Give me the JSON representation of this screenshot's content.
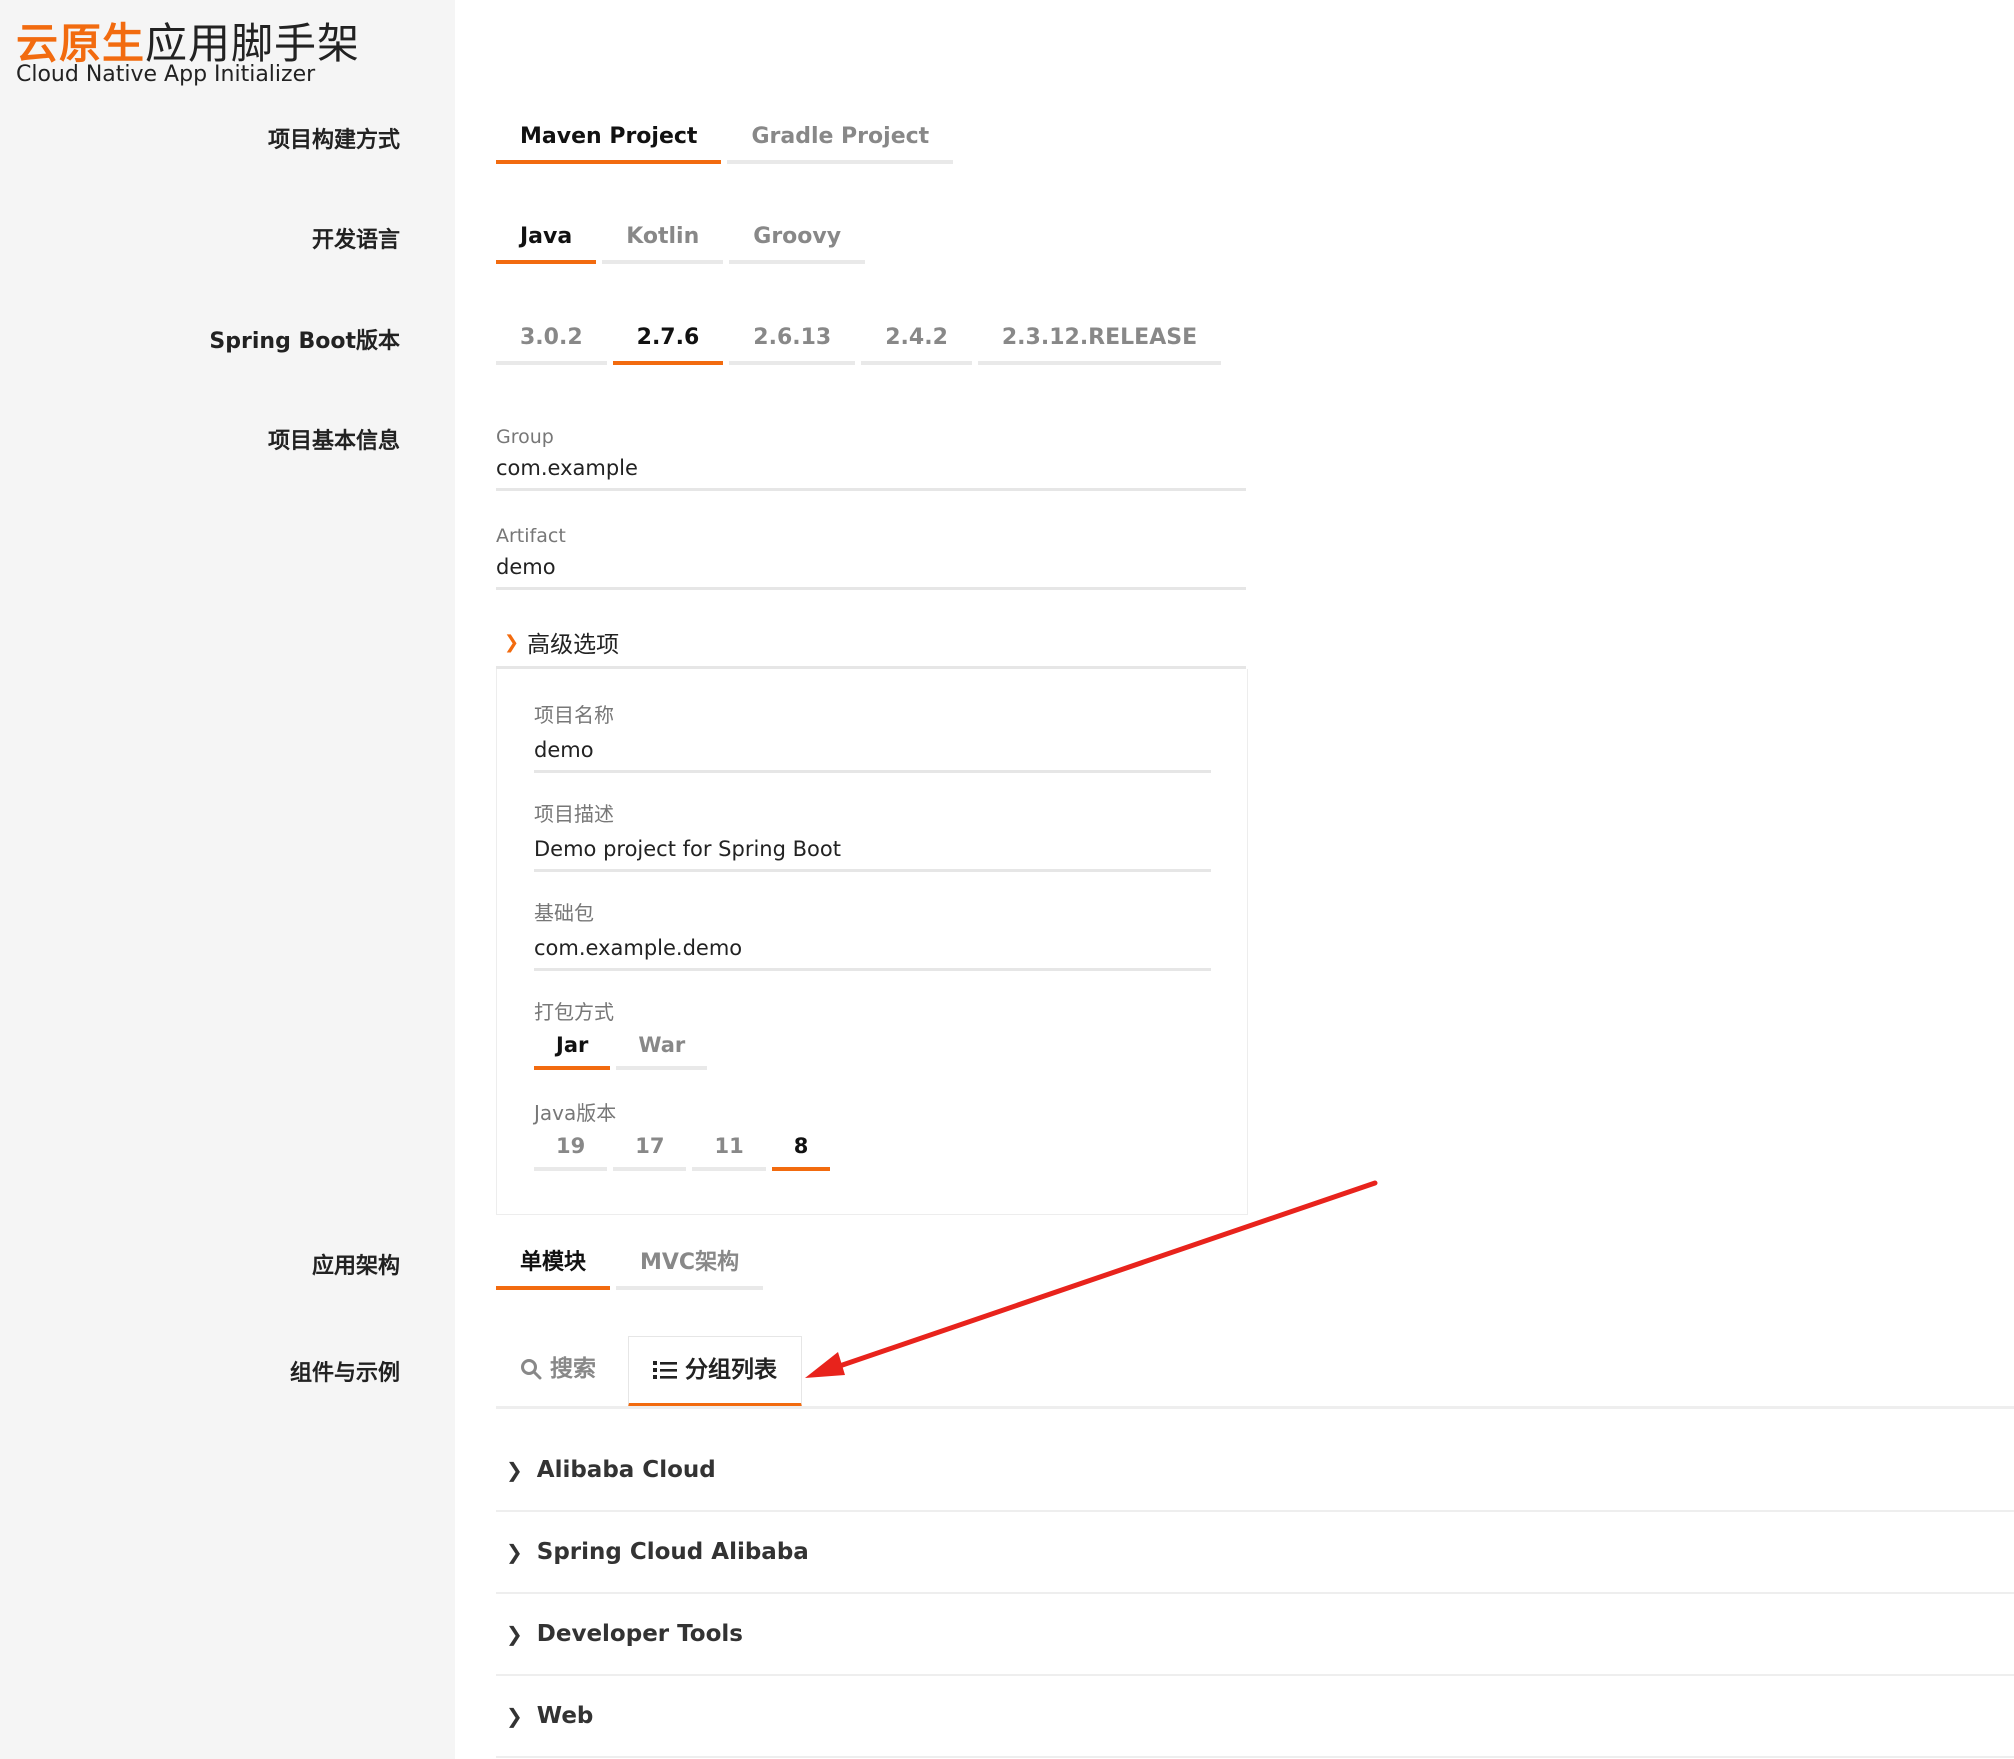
{
  "brand": {
    "title_accent": "云原生",
    "title_rest": "应用脚手架",
    "subtitle": "Cloud Native App Initializer",
    "accent_color": "#f26b0f"
  },
  "sections": {
    "build": "项目构建方式",
    "language": "开发语言",
    "boot_version": "Spring Boot版本",
    "basic_info": "项目基本信息",
    "architecture": "应用架构",
    "components": "组件与示例"
  },
  "build_tabs": {
    "active": "Maven Project",
    "items": [
      "Maven Project",
      "Gradle Project"
    ]
  },
  "language_tabs": {
    "active": "Java",
    "items": [
      "Java",
      "Kotlin",
      "Groovy"
    ]
  },
  "boot_tabs": {
    "active": "2.7.6",
    "items": [
      "3.0.2",
      "2.7.6",
      "2.6.13",
      "2.4.2",
      "2.3.12.RELEASE"
    ]
  },
  "basic": {
    "group_label": "Group",
    "group_value": "com.example",
    "artifact_label": "Artifact",
    "artifact_value": "demo",
    "advanced_label": "高级选项"
  },
  "advanced": {
    "name_label": "项目名称",
    "name_value": "demo",
    "desc_label": "项目描述",
    "desc_value": "Demo project for Spring Boot",
    "package_label": "基础包",
    "package_value": "com.example.demo",
    "packaging_label": "打包方式",
    "packaging_tabs": {
      "active": "Jar",
      "items": [
        "Jar",
        "War"
      ]
    },
    "java_label": "Java版本",
    "java_tabs": {
      "active": "8",
      "items": [
        "19",
        "17",
        "11",
        "8"
      ]
    }
  },
  "architecture_tabs": {
    "active": "单模块",
    "items": [
      "单模块",
      "MVC架构"
    ]
  },
  "component_tabs": {
    "search": "搜索",
    "group_list": "分组列表"
  },
  "groups": [
    "Alibaba Cloud",
    "Spring Cloud Alibaba",
    "Developer Tools",
    "Web"
  ]
}
